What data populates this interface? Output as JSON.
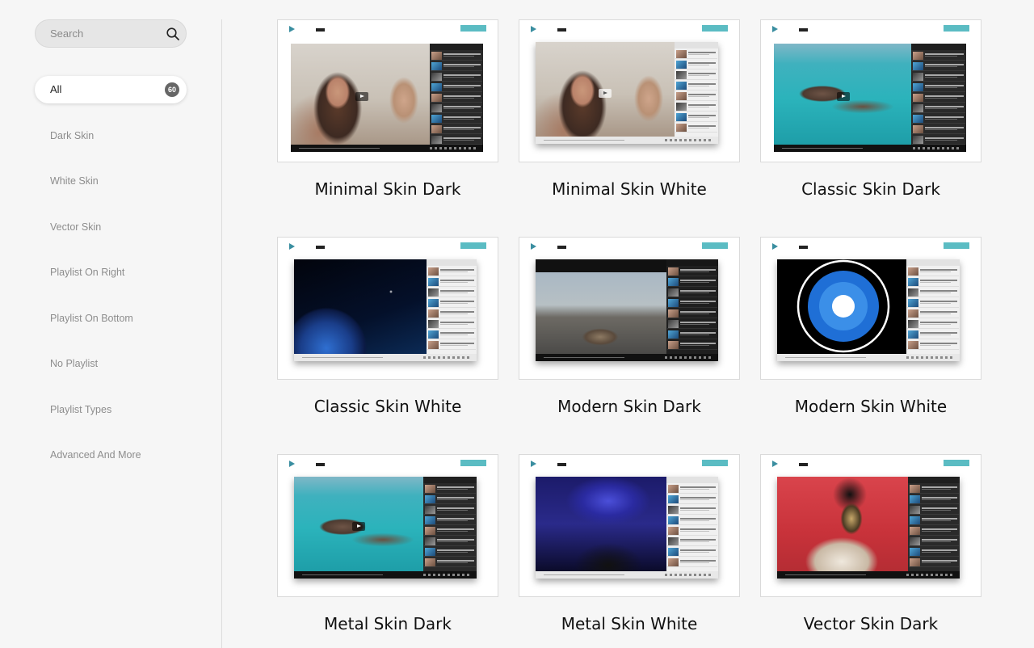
{
  "search": {
    "placeholder": "Search"
  },
  "categories": [
    {
      "label": "All",
      "count": "60",
      "active": true
    },
    {
      "label": "Dark Skin"
    },
    {
      "label": "White Skin"
    },
    {
      "label": "Vector Skin"
    },
    {
      "label": "Playlist On Right"
    },
    {
      "label": "Playlist On Bottom"
    },
    {
      "label": "No Playlist"
    },
    {
      "label": "Playlist Types"
    },
    {
      "label": "Advanced And More"
    }
  ],
  "cards": [
    {
      "title": "Minimal Skin Dark"
    },
    {
      "title": "Minimal Skin White"
    },
    {
      "title": "Classic Skin Dark"
    },
    {
      "title": "Classic Skin White"
    },
    {
      "title": "Modern Skin Dark"
    },
    {
      "title": "Modern Skin White"
    },
    {
      "title": "Metal Skin Dark"
    },
    {
      "title": "Metal Skin White"
    },
    {
      "title": "Vector Skin Dark"
    }
  ],
  "colors": {
    "accent": "#5bbcc3",
    "badge": "#666666"
  },
  "icons": {
    "search": "search-icon"
  }
}
